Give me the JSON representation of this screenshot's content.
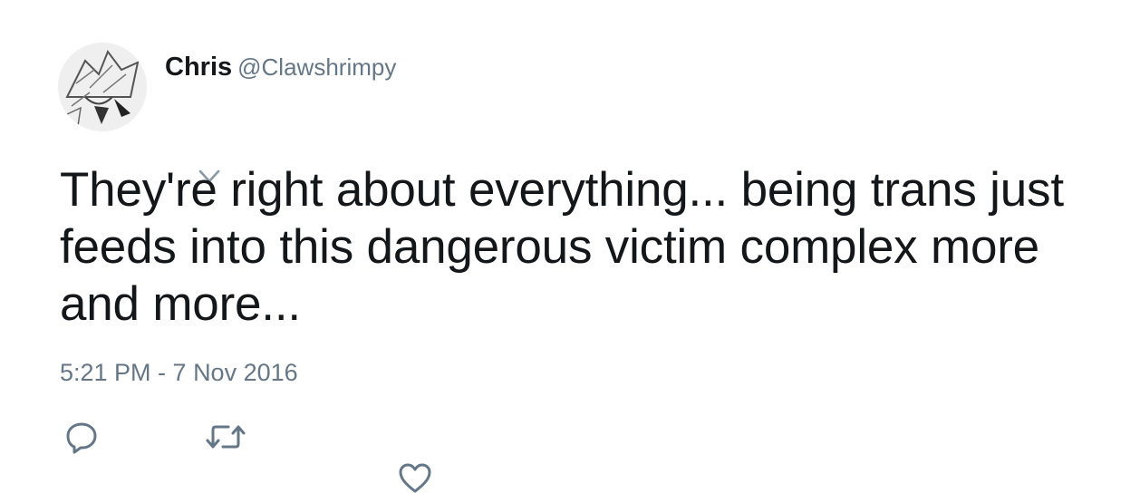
{
  "author": {
    "display_name": "Chris",
    "handle": "@Clawshrimpy"
  },
  "tweet": {
    "text": "They're right about everything... being trans just feeds into this dangerous victim complex more and more...",
    "timestamp": "5:21 PM - 7 Nov 2016"
  },
  "actions": {
    "reply_icon": "reply-icon",
    "retweet_icon": "retweet-icon",
    "like_icon": "heart-icon",
    "menu_icon": "chevron-down-icon"
  },
  "colors": {
    "text": "#14171a",
    "secondary": "#657786"
  }
}
